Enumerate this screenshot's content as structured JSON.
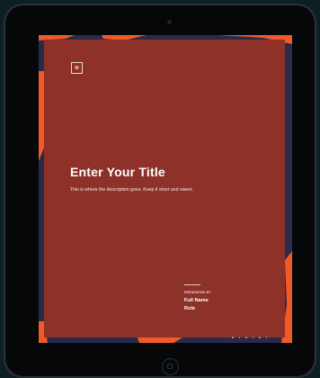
{
  "slide": {
    "logo_text": "M",
    "title": "Enter Your Title",
    "description": "This is where the description goes. Keep it short and sweet.",
    "presented_by": "PRESENTED BY",
    "full_name": "Full Name",
    "role": "Role"
  },
  "colors": {
    "background": "#0d1f22",
    "device": "#060708",
    "slide": "#8e3128",
    "frame": "#2a2a4a",
    "accent": "#f05a28"
  },
  "icons": {
    "logo": "logo-mark-icon",
    "home": "home-button-icon",
    "camera": "camera-icon"
  }
}
